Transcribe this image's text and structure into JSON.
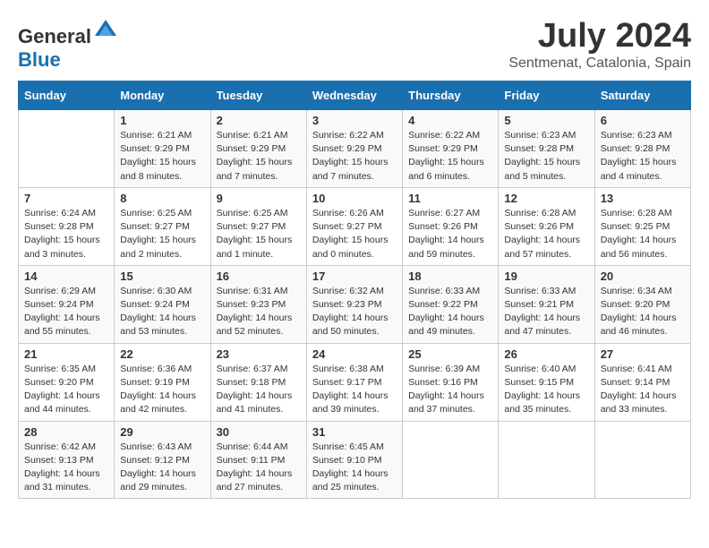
{
  "header": {
    "logo_general": "General",
    "logo_blue": "Blue",
    "month_year": "July 2024",
    "location": "Sentmenat, Catalonia, Spain"
  },
  "days_of_week": [
    "Sunday",
    "Monday",
    "Tuesday",
    "Wednesday",
    "Thursday",
    "Friday",
    "Saturday"
  ],
  "weeks": [
    [
      {
        "day": "",
        "info": ""
      },
      {
        "day": "1",
        "info": "Sunrise: 6:21 AM\nSunset: 9:29 PM\nDaylight: 15 hours\nand 8 minutes."
      },
      {
        "day": "2",
        "info": "Sunrise: 6:21 AM\nSunset: 9:29 PM\nDaylight: 15 hours\nand 7 minutes."
      },
      {
        "day": "3",
        "info": "Sunrise: 6:22 AM\nSunset: 9:29 PM\nDaylight: 15 hours\nand 7 minutes."
      },
      {
        "day": "4",
        "info": "Sunrise: 6:22 AM\nSunset: 9:29 PM\nDaylight: 15 hours\nand 6 minutes."
      },
      {
        "day": "5",
        "info": "Sunrise: 6:23 AM\nSunset: 9:28 PM\nDaylight: 15 hours\nand 5 minutes."
      },
      {
        "day": "6",
        "info": "Sunrise: 6:23 AM\nSunset: 9:28 PM\nDaylight: 15 hours\nand 4 minutes."
      }
    ],
    [
      {
        "day": "7",
        "info": "Sunrise: 6:24 AM\nSunset: 9:28 PM\nDaylight: 15 hours\nand 3 minutes."
      },
      {
        "day": "8",
        "info": "Sunrise: 6:25 AM\nSunset: 9:27 PM\nDaylight: 15 hours\nand 2 minutes."
      },
      {
        "day": "9",
        "info": "Sunrise: 6:25 AM\nSunset: 9:27 PM\nDaylight: 15 hours\nand 1 minute."
      },
      {
        "day": "10",
        "info": "Sunrise: 6:26 AM\nSunset: 9:27 PM\nDaylight: 15 hours\nand 0 minutes."
      },
      {
        "day": "11",
        "info": "Sunrise: 6:27 AM\nSunset: 9:26 PM\nDaylight: 14 hours\nand 59 minutes."
      },
      {
        "day": "12",
        "info": "Sunrise: 6:28 AM\nSunset: 9:26 PM\nDaylight: 14 hours\nand 57 minutes."
      },
      {
        "day": "13",
        "info": "Sunrise: 6:28 AM\nSunset: 9:25 PM\nDaylight: 14 hours\nand 56 minutes."
      }
    ],
    [
      {
        "day": "14",
        "info": "Sunrise: 6:29 AM\nSunset: 9:24 PM\nDaylight: 14 hours\nand 55 minutes."
      },
      {
        "day": "15",
        "info": "Sunrise: 6:30 AM\nSunset: 9:24 PM\nDaylight: 14 hours\nand 53 minutes."
      },
      {
        "day": "16",
        "info": "Sunrise: 6:31 AM\nSunset: 9:23 PM\nDaylight: 14 hours\nand 52 minutes."
      },
      {
        "day": "17",
        "info": "Sunrise: 6:32 AM\nSunset: 9:23 PM\nDaylight: 14 hours\nand 50 minutes."
      },
      {
        "day": "18",
        "info": "Sunrise: 6:33 AM\nSunset: 9:22 PM\nDaylight: 14 hours\nand 49 minutes."
      },
      {
        "day": "19",
        "info": "Sunrise: 6:33 AM\nSunset: 9:21 PM\nDaylight: 14 hours\nand 47 minutes."
      },
      {
        "day": "20",
        "info": "Sunrise: 6:34 AM\nSunset: 9:20 PM\nDaylight: 14 hours\nand 46 minutes."
      }
    ],
    [
      {
        "day": "21",
        "info": "Sunrise: 6:35 AM\nSunset: 9:20 PM\nDaylight: 14 hours\nand 44 minutes."
      },
      {
        "day": "22",
        "info": "Sunrise: 6:36 AM\nSunset: 9:19 PM\nDaylight: 14 hours\nand 42 minutes."
      },
      {
        "day": "23",
        "info": "Sunrise: 6:37 AM\nSunset: 9:18 PM\nDaylight: 14 hours\nand 41 minutes."
      },
      {
        "day": "24",
        "info": "Sunrise: 6:38 AM\nSunset: 9:17 PM\nDaylight: 14 hours\nand 39 minutes."
      },
      {
        "day": "25",
        "info": "Sunrise: 6:39 AM\nSunset: 9:16 PM\nDaylight: 14 hours\nand 37 minutes."
      },
      {
        "day": "26",
        "info": "Sunrise: 6:40 AM\nSunset: 9:15 PM\nDaylight: 14 hours\nand 35 minutes."
      },
      {
        "day": "27",
        "info": "Sunrise: 6:41 AM\nSunset: 9:14 PM\nDaylight: 14 hours\nand 33 minutes."
      }
    ],
    [
      {
        "day": "28",
        "info": "Sunrise: 6:42 AM\nSunset: 9:13 PM\nDaylight: 14 hours\nand 31 minutes."
      },
      {
        "day": "29",
        "info": "Sunrise: 6:43 AM\nSunset: 9:12 PM\nDaylight: 14 hours\nand 29 minutes."
      },
      {
        "day": "30",
        "info": "Sunrise: 6:44 AM\nSunset: 9:11 PM\nDaylight: 14 hours\nand 27 minutes."
      },
      {
        "day": "31",
        "info": "Sunrise: 6:45 AM\nSunset: 9:10 PM\nDaylight: 14 hours\nand 25 minutes."
      },
      {
        "day": "",
        "info": ""
      },
      {
        "day": "",
        "info": ""
      },
      {
        "day": "",
        "info": ""
      }
    ]
  ]
}
